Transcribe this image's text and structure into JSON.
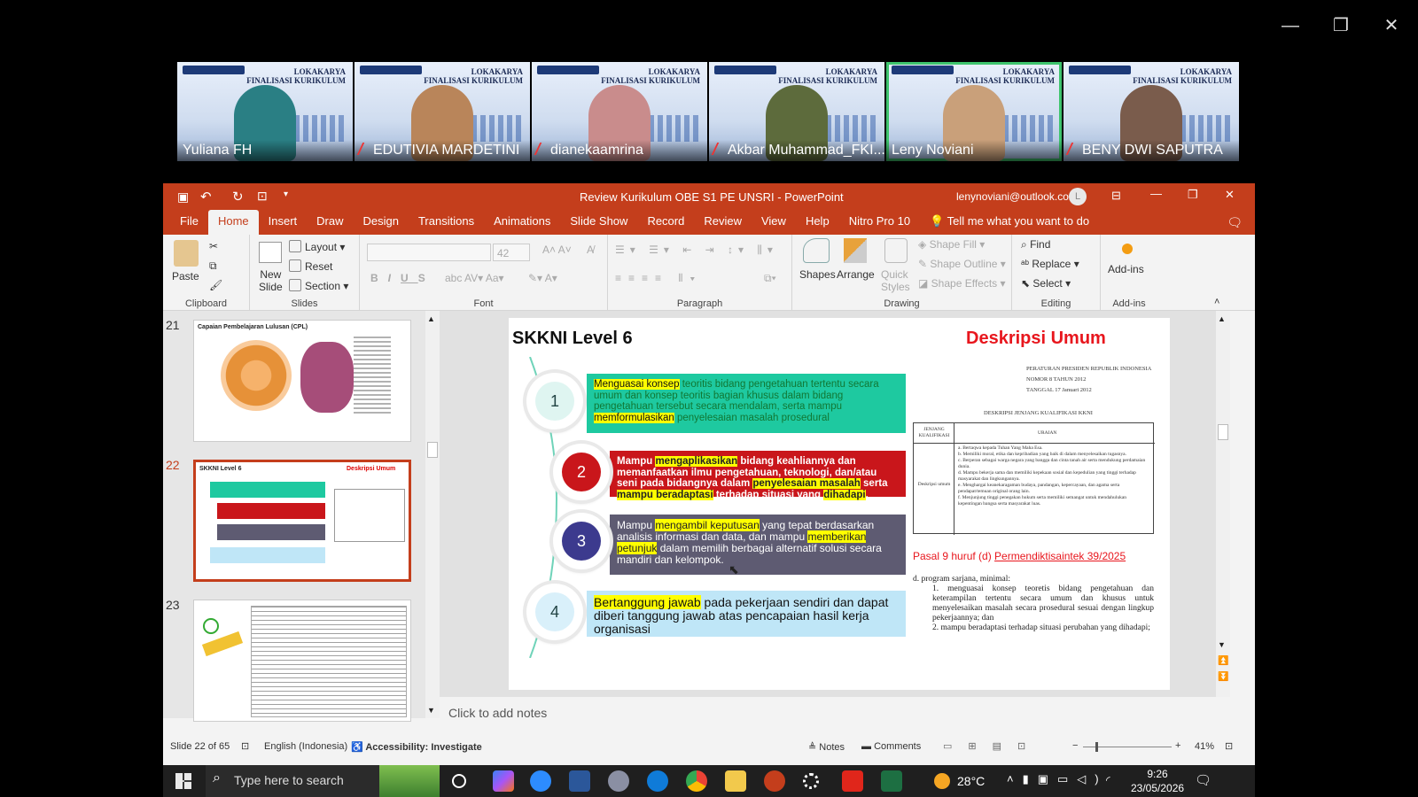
{
  "window_controls": {
    "minimize": "—",
    "restore": "❐",
    "close": "✕"
  },
  "participants": [
    {
      "name": "Yuliana FH",
      "muted": false,
      "active": false
    },
    {
      "name": "EDUTIVIA MARDETINI",
      "muted": true,
      "active": false
    },
    {
      "name": "dianekaamrina",
      "muted": true,
      "active": false
    },
    {
      "name": "Akbar Muhammad_FKI...",
      "muted": true,
      "active": false
    },
    {
      "name": "Leny Noviani",
      "muted": false,
      "active": true
    },
    {
      "name": "BENY DWI SAPUTRA",
      "muted": true,
      "active": false
    }
  ],
  "tile_banner": {
    "line1": "LOKAKARYA",
    "line2": "FINALISASI KURIKULUM"
  },
  "ppt": {
    "title": "Review Kurikulum OBE S1 PE UNSRI  -  PowerPoint",
    "account": "lenynoviani@outlook.com",
    "avatar": "L",
    "tabs": [
      "File",
      "Home",
      "Insert",
      "Draw",
      "Design",
      "Transitions",
      "Animations",
      "Slide Show",
      "Record",
      "Review",
      "View",
      "Help",
      "Nitro Pro 10"
    ],
    "tell_me": "Tell me what you want to do",
    "ribbon": {
      "clipboard": {
        "label": "Clipboard",
        "paste": "Paste"
      },
      "slides": {
        "label": "Slides",
        "new_slide_1": "New",
        "new_slide_2": "Slide",
        "layout": "Layout",
        "reset": "Reset",
        "section": "Section"
      },
      "font": {
        "label": "Font",
        "size": "42"
      },
      "paragraph": {
        "label": "Paragraph"
      },
      "drawing": {
        "label": "Drawing",
        "shapes": "Shapes",
        "arrange": "Arrange",
        "quick_styles_1": "Quick",
        "quick_styles_2": "Styles",
        "shape_fill": "Shape Fill",
        "shape_outline": "Shape Outline",
        "shape_effects": "Shape Effects"
      },
      "editing": {
        "label": "Editing",
        "find": "Find",
        "replace": "Replace",
        "select": "Select"
      },
      "addins": {
        "label": "Add-ins",
        "button": "Add-ins"
      }
    },
    "thumbnails": [
      {
        "num": "21",
        "title": "Capaian Pembelajaran Lulusan (CPL)",
        "selected": false
      },
      {
        "num": "22",
        "title": "SKKNI Level 6",
        "right": "Deskripsi Umum",
        "selected": true
      },
      {
        "num": "23",
        "title": "",
        "selected": false
      }
    ],
    "slide": {
      "title": "SKKNI Level 6",
      "heading_right": "Deskripsi Umum",
      "items": [
        {
          "num": "1",
          "hl1": "Menguasai konsep",
          "t1": " teoritis bidang pengetahuan tertentu secara umum dan konsep teoritis bagian khusus dalam bidang pengetahuan tersebut secara mendalam, serta mampu ",
          "hl2": "memformulasikan",
          "t2": " penyelesaian masalah prosedural",
          "color": "#1ec9a0"
        },
        {
          "num": "2",
          "t0": "Mampu ",
          "hl1": "mengaplikasikan",
          "t1": " bidang keahliannya dan memanfaatkan ilmu pengetahuan, teknologi, dan/atau seni pada bidangnya dalam ",
          "hl2": "penyelesaian masalah",
          "t2": " serta ",
          "hl3": "mampu beradaptasi",
          "t3": " terhadap situasi yang ",
          "hl4": "dihadapi",
          "t4": ".",
          "color": "#c9161b"
        },
        {
          "num": "3",
          "t0": "Mampu ",
          "hl1": "mengambil keputusan",
          "t1": " yang tepat berdasarkan analisis informasi dan data, dan mampu ",
          "hl2": "memberikan petunjuk",
          "t2": " dalam memilih berbagai alternatif solusi secara mandiri dan kelompok.",
          "color": "#5e5b72"
        },
        {
          "num": "4",
          "hl1": "Bertanggung jawab",
          "t1": " pada pekerjaan sendiri dan dapat diberi tanggung jawab atas pencapaian hasil kerja organisasi",
          "color": "#bfe6f7"
        }
      ],
      "reg_line1": "PERATURAN PRESIDEN REPUBLIK INDONESIA",
      "reg_line2": "NOMOR   8   TAHUN 2012",
      "reg_line3": "TANGGAL  17 Januari 2012",
      "table_title": "DESKRIPSI JENJANG KUALIFIKASI KKNI",
      "table_h1": "JENJANG KUALIFIKASI",
      "table_h2": "URAIAN",
      "table_row_label": "Deskripsi umum",
      "table_items": [
        "a.   Bertaqwa kepada Tuhan Yang Maha Esa.",
        "b.   Memiliki moral, etika dan kepribadian yang baik di dalam menyelesaikan tugasnya.",
        "c.   Berperan sebagai warga negara yang bangga dan cinta tanah air serta mendukung perdamaian dunia.",
        "d.   Mampu bekerja sama dan memiliki kepekaan sosial dan kepedulian yang tinggi terhadap masyarakat dan lingkungannya.",
        "e.   Menghargai keanekaragaman budaya, pandangan, kepercayaan, dan agama serta pendapat/temuan original orang lain.",
        "f.   Menjunjung tinggi penegakan hukum serta memiliki semangat untuk mendahulukan kepentingan bangsa serta masyarakat luas."
      ],
      "pasal_prefix": "Pasal 9 huruf (d) ",
      "pasal_link": "Permendiktisaintek 39/2025",
      "d_head": "d.      program sarjana, minimal:",
      "d1": "1.     menguasai konsep teoretis bidang pengetahuan dan keterampilan tertentu secara umum dan khusus untuk menyelesaikan masalah secara prosedural sesuai dengan lingkup pekerjaannya; dan",
      "d2": "2.     mampu beradaptasi terhadap situasi perubahan yang dihadapi;"
    },
    "notes_placeholder": "Click to add notes",
    "status": {
      "slide": "Slide 22 of 65",
      "language": "English (Indonesia)",
      "accessibility": "Accessibility: Investigate",
      "notes": "Notes",
      "comments": "Comments",
      "zoom": "41%"
    }
  },
  "taskbar": {
    "search_placeholder": "Type here to search",
    "temp": "28°C",
    "time": "9:26",
    "date": "23/05/2026"
  },
  "colors": {
    "ppt_red": "#c43e1c",
    "active_speaker": "#3ec46d"
  }
}
